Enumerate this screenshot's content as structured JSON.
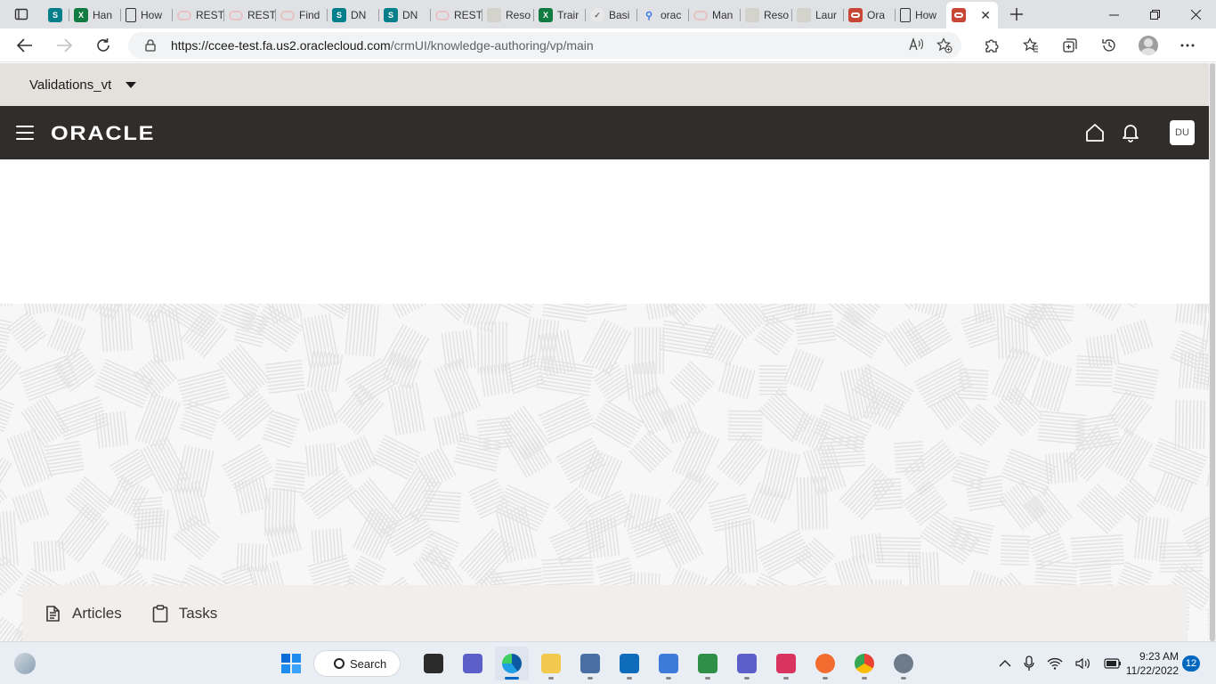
{
  "browser": {
    "tabs": [
      {
        "title": "",
        "icon": "sharepoint-icon",
        "color": "#037f8c"
      },
      {
        "title": "Han",
        "icon": "excel-icon",
        "color": "#107c41"
      },
      {
        "title": "How",
        "icon": "page-icon",
        "color": "#ffffff"
      },
      {
        "title": "REST",
        "icon": "oracle-outline-icon",
        "color": "#e8c3c3"
      },
      {
        "title": "REST",
        "icon": "oracle-outline-icon",
        "color": "#e8c3c3"
      },
      {
        "title": "Find",
        "icon": "oracle-outline-icon",
        "color": "#e8c3c3"
      },
      {
        "title": "DN",
        "icon": "sharepoint-icon",
        "color": "#037f8c"
      },
      {
        "title": "DN",
        "icon": "sharepoint-icon",
        "color": "#037f8c"
      },
      {
        "title": "REST",
        "icon": "oracle-outline-icon",
        "color": "#e8c3c3"
      },
      {
        "title": "Reso",
        "icon": "generic-site-icon",
        "color": "#cfcfc4"
      },
      {
        "title": "Trair",
        "icon": "excel-icon",
        "color": "#107c41"
      },
      {
        "title": "Basi",
        "icon": "check-circle-icon",
        "color": "#ffffff"
      },
      {
        "title": "orac",
        "icon": "search-icon",
        "color": "#ffffff"
      },
      {
        "title": "Man",
        "icon": "oracle-outline-icon",
        "color": "#e8c3c3"
      },
      {
        "title": "Reso",
        "icon": "generic-site-icon",
        "color": "#cfcfc4"
      },
      {
        "title": "Laur",
        "icon": "generic-site-icon",
        "color": "#cfcfc4"
      },
      {
        "title": "Ora",
        "icon": "oracle-red-icon",
        "color": "#c74634"
      },
      {
        "title": "How",
        "icon": "page-icon",
        "color": "#ffffff"
      }
    ],
    "active_tab": {
      "title": "",
      "icon": "oracle-red-icon",
      "color": "#c74634"
    },
    "url_host": "https://ccee-test.fa.us2.oraclecloud.com",
    "url_path": "/crmUI/knowledge-authoring/vp/main"
  },
  "app": {
    "sandbox_name": "Validations_vt",
    "logo_text": "ORACLE",
    "user_initials": "DU",
    "header_color": "#312d2a",
    "nav_items": [
      {
        "label": "Articles",
        "icon": "articles-icon"
      },
      {
        "label": "Tasks",
        "icon": "clipboard-icon"
      }
    ]
  },
  "taskbar": {
    "search_label": "Search",
    "time": "9:23 AM",
    "date": "11/22/2022",
    "notification_count": "12",
    "apps": [
      {
        "icon": "task-view-icon",
        "color": "#2b2b2b",
        "active": false
      },
      {
        "icon": "teams-chat-icon",
        "color": "#5b5fc7",
        "active": false
      },
      {
        "icon": "edge-icon",
        "color": "#1fa0e4",
        "active": true
      },
      {
        "icon": "file-explorer-icon",
        "color": "#f2c94c",
        "active": false
      },
      {
        "icon": "remote-desktop-icon",
        "color": "#4a6fa5",
        "active": false
      },
      {
        "icon": "outlook-icon",
        "color": "#0f6cbd",
        "active": false
      },
      {
        "icon": "notepad-icon",
        "color": "#3d7bd9",
        "active": false
      },
      {
        "icon": "spreadsheet-compare-icon",
        "color": "#2f8f46",
        "active": false
      },
      {
        "icon": "teams-icon",
        "color": "#5b5fc7",
        "active": false
      },
      {
        "icon": "snipping-tool-icon",
        "color": "#d8345f",
        "active": false
      },
      {
        "icon": "pen-tool-icon",
        "color": "#f26b2f",
        "active": false
      },
      {
        "icon": "chrome-icon",
        "color": "#ea4335",
        "active": false
      },
      {
        "icon": "settings-icon",
        "color": "#6e7b8a",
        "active": false
      }
    ]
  }
}
